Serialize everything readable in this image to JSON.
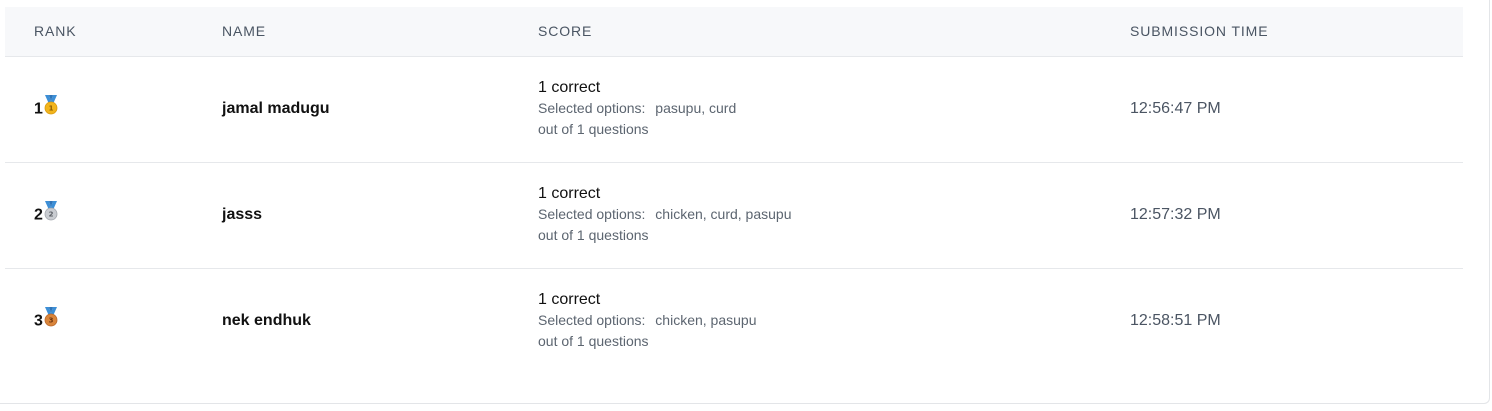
{
  "table": {
    "headers": {
      "rank": "RANK",
      "name": "NAME",
      "score": "SCORE",
      "submission_time": "SUBMISSION TIME"
    },
    "rows": [
      {
        "rank": "1",
        "medal": "gold-medal-icon",
        "name": "jamal madugu",
        "score": "1 correct",
        "selected_label": "Selected options:",
        "selected_options": "pasupu, curd",
        "out_of": "out of 1 questions",
        "time": "12:56:47 PM"
      },
      {
        "rank": "2",
        "medal": "silver-medal-icon",
        "name": "jasss",
        "score": "1 correct",
        "selected_label": "Selected options:",
        "selected_options": "chicken, curd, pasupu",
        "out_of": "out of 1 questions",
        "time": "12:57:32 PM"
      },
      {
        "rank": "3",
        "medal": "bronze-medal-icon",
        "name": "nek endhuk",
        "score": "1 correct",
        "selected_label": "Selected options:",
        "selected_options": "chicken, pasupu",
        "out_of": "out of 1 questions",
        "time": "12:58:51 PM"
      }
    ]
  },
  "colors": {
    "header_bg": "#f7f8fa",
    "gold": "#f2b51d",
    "silver": "#c9ccd1",
    "bronze": "#d9853b",
    "ribbon": "#3d8fd6"
  }
}
